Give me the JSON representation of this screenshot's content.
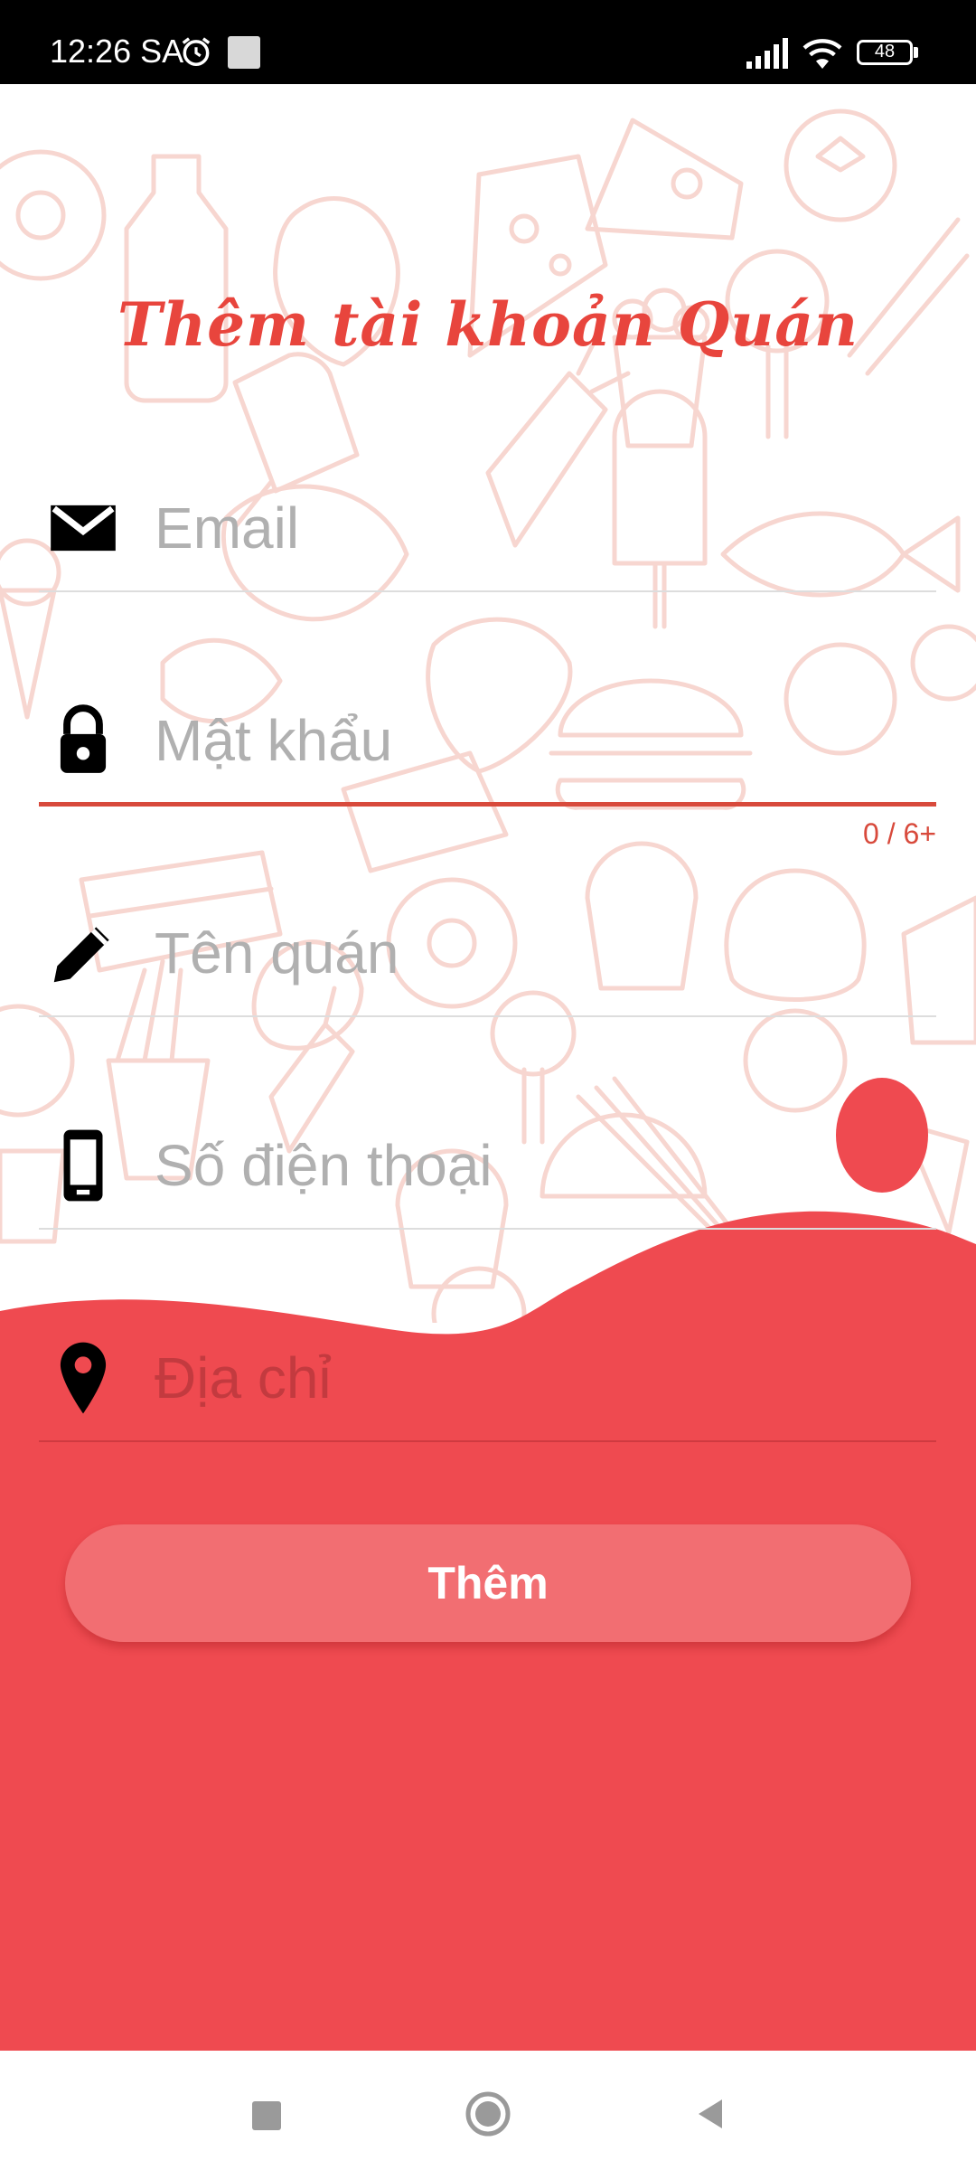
{
  "status_bar": {
    "time": "12:26 SA",
    "battery": "48"
  },
  "title": "Thêm tài khoản Quán",
  "fields": {
    "email": {
      "placeholder": "Email",
      "icon": "mail-icon"
    },
    "password": {
      "placeholder": "Mật khẩu",
      "icon": "lock-icon",
      "counter": "0 / 6+"
    },
    "shop_name": {
      "placeholder": "Tên quán",
      "icon": "pencil-icon"
    },
    "phone": {
      "placeholder": "Số điện thoại",
      "icon": "phone-icon"
    },
    "address": {
      "placeholder": "Địa chỉ",
      "icon": "location-pin-icon"
    }
  },
  "submit_label": "Thêm",
  "colors": {
    "accent": "#ef4a50",
    "title": "#e8453d",
    "button": "#f26e72"
  }
}
